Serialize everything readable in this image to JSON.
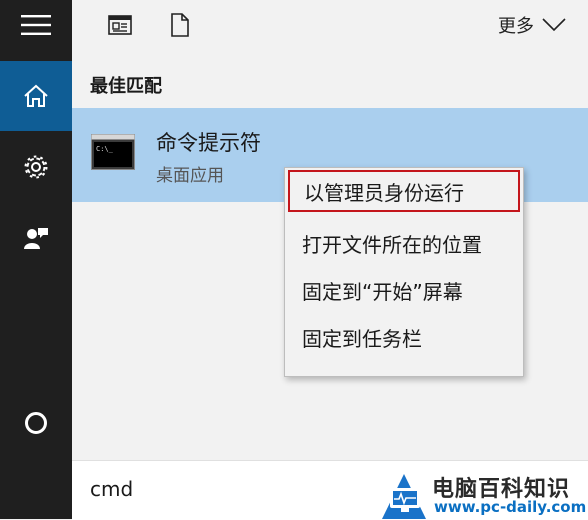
{
  "toolbar": {
    "more_label": "更多"
  },
  "icons": {
    "menu": "hamburger-menu-icon",
    "home": "home-icon",
    "settings": "gear-icon",
    "feedback": "person-feedback-icon",
    "cortana": "cortana-circle-icon",
    "filter_apps": "document-grid-icon",
    "filter_docs": "document-icon",
    "more": "chevron-down-icon",
    "app": "command-prompt-icon"
  },
  "results": {
    "section_title": "最佳匹配",
    "best_match": {
      "title": "命令提示符",
      "subtitle": "桌面应用",
      "icon_text": "C:\\_"
    }
  },
  "context_menu": {
    "items": [
      "以管理员身份运行",
      "打开文件所在的位置",
      "固定到“开始”屏幕",
      "固定到任务栏"
    ]
  },
  "search": {
    "query": "cmd"
  },
  "watermark": {
    "title": "电脑百科知识",
    "url": "www.pc-daily.com"
  },
  "colors": {
    "rail": "#1f1f1f",
    "active_rail": "#0f5d95",
    "selection": "#aacfee",
    "highlight_border": "#c4161c"
  }
}
